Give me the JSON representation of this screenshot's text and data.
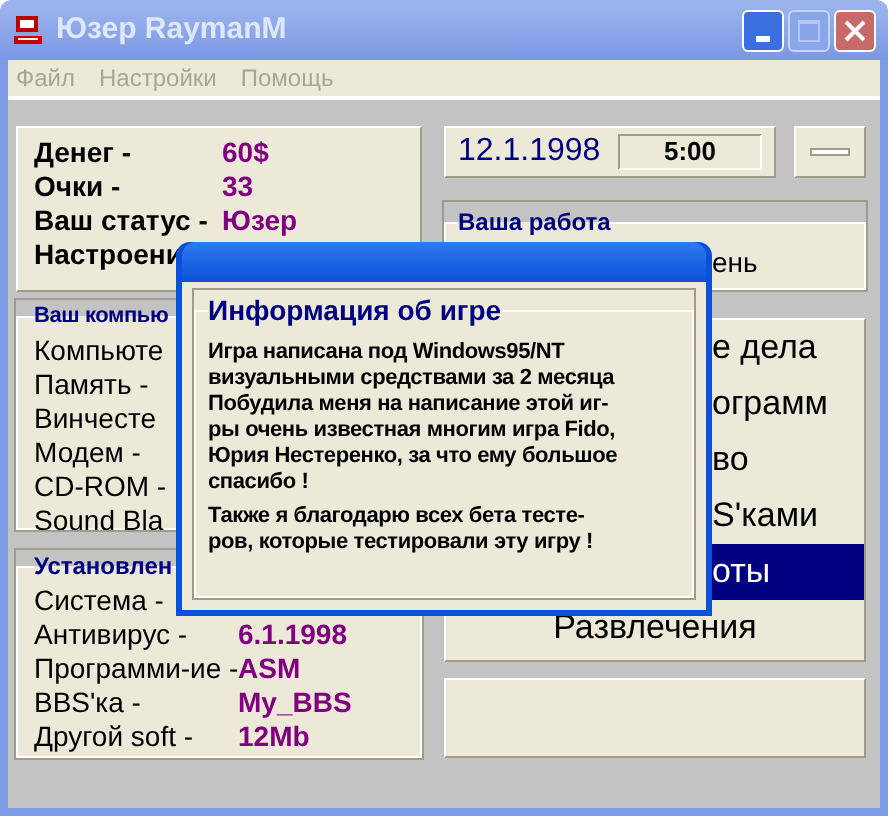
{
  "window": {
    "title": "Юзер RaymanM"
  },
  "menu": [
    {
      "label": "Файл",
      "disabled": true
    },
    {
      "label": "Настройки",
      "disabled": true
    },
    {
      "label": "Помощь",
      "disabled": true
    }
  ],
  "stats": [
    {
      "label": "Денег -",
      "value": "60$"
    },
    {
      "label": "Очки -",
      "value": "33"
    },
    {
      "label": "Ваш статус -",
      "value": "Юзер"
    },
    {
      "label": "Настроени"
    }
  ],
  "computer": {
    "title": "Ваш компью",
    "items": [
      "Компьюте",
      "Память -",
      "Винчесте",
      "Модем -",
      "CD-ROM -",
      "Sound Bla"
    ]
  },
  "installed": {
    "title": "Установлен",
    "items": [
      {
        "label": "Система -"
      },
      {
        "label": "Антивирус -",
        "value": "6.1.1998"
      },
      {
        "label": "Программи-ие -",
        "value": "ASM"
      },
      {
        "label": "BBS'ка -",
        "value": "My_BBS"
      },
      {
        "label": "Другой soft -",
        "value": "12Mb"
      }
    ]
  },
  "date": "12.1.1998",
  "time": "5:00",
  "work": {
    "title": "Ваша работа",
    "value": "ень"
  },
  "actions": [
    {
      "label": "е дела",
      "selected": false,
      "kind": "partial"
    },
    {
      "label": "ограмм",
      "selected": false,
      "kind": "partial"
    },
    {
      "label": "во",
      "selected": false,
      "kind": "partial"
    },
    {
      "label": "S'ками",
      "selected": false,
      "kind": "partial"
    },
    {
      "label": "оты",
      "selected": true,
      "kind": "partial"
    },
    {
      "label": "Развлечения",
      "selected": false,
      "kind": "full"
    }
  ],
  "dialog": {
    "group_title": "Информация об игре",
    "paragraphs": [
      "Игра написана под Windows95/NT\nвизуальными средствами за 2 месяца\nПобудила меня на написание этой иг-\nры очень известная многим игра Fido,\nЮрия Нестеренко, за что ему большое\nспасибо !",
      "Также я благодарю всех бета тесте-\nров, которые тестировали эту игру !"
    ]
  }
}
